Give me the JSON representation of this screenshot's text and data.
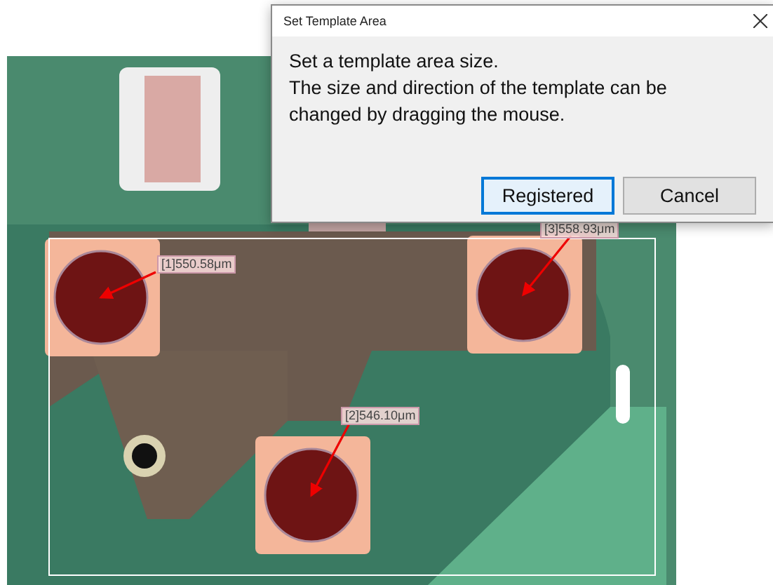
{
  "dialog": {
    "title": "Set Template Area",
    "message_lines": [
      "Set a template area size.",
      "The size and direction of the template can be",
      "changed by dragging the mouse."
    ],
    "buttons": [
      {
        "label": "Registered",
        "selected": true
      },
      {
        "label": "Cancel",
        "selected": false
      }
    ]
  },
  "image": {
    "measurements": [
      {
        "label": "[1]550.58μm"
      },
      {
        "label": "[2]546.10μm"
      },
      {
        "label": "[3]558.93μm"
      }
    ]
  }
}
